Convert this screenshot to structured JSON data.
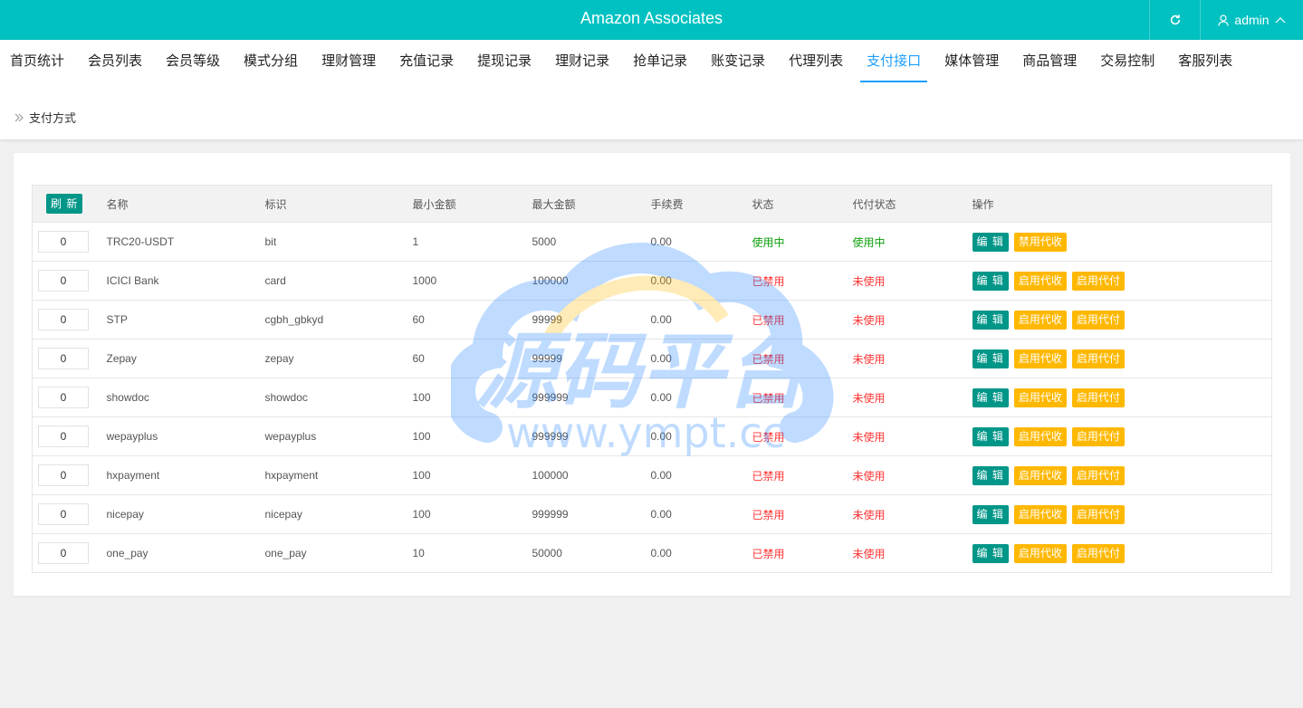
{
  "header": {
    "title": "Amazon Associates",
    "user": "admin"
  },
  "nav": {
    "tabs": [
      "首页统计",
      "会员列表",
      "会员等级",
      "模式分组",
      "理财管理",
      "充值记录",
      "提现记录",
      "理财记录",
      "抢单记录",
      "账变记录",
      "代理列表",
      "支付接口",
      "媒体管理",
      "商品管理",
      "交易控制",
      "客服列表"
    ],
    "active_index": 11
  },
  "breadcrumb": {
    "label": "支付方式"
  },
  "table": {
    "refresh_label": "刷 新",
    "columns": [
      "名称",
      "标识",
      "最小金额",
      "最大金额",
      "手续费",
      "状态",
      "代付状态",
      "操作"
    ],
    "rows": [
      {
        "sort": "0",
        "name": "TRC20-USDT",
        "code": "bit",
        "min": "1",
        "max": "5000",
        "fee": "0.00",
        "status": "使用中",
        "payout_status": "使用中",
        "actions": [
          "编 辑",
          "禁用代收"
        ]
      },
      {
        "sort": "0",
        "name": "ICICI Bank",
        "code": "card",
        "min": "1000",
        "max": "100000",
        "fee": "0.00",
        "status": "已禁用",
        "payout_status": "未使用",
        "actions": [
          "编 辑",
          "启用代收",
          "启用代付"
        ]
      },
      {
        "sort": "0",
        "name": "STP",
        "code": "cgbh_gbkyd",
        "min": "60",
        "max": "99999",
        "fee": "0.00",
        "status": "已禁用",
        "payout_status": "未使用",
        "actions": [
          "编 辑",
          "启用代收",
          "启用代付"
        ]
      },
      {
        "sort": "0",
        "name": "Zepay",
        "code": "zepay",
        "min": "60",
        "max": "99999",
        "fee": "0.00",
        "status": "已禁用",
        "payout_status": "未使用",
        "actions": [
          "编 辑",
          "启用代收",
          "启用代付"
        ]
      },
      {
        "sort": "0",
        "name": "showdoc",
        "code": "showdoc",
        "min": "100",
        "max": "999999",
        "fee": "0.00",
        "status": "已禁用",
        "payout_status": "未使用",
        "actions": [
          "编 辑",
          "启用代收",
          "启用代付"
        ]
      },
      {
        "sort": "0",
        "name": "wepayplus",
        "code": "wepayplus",
        "min": "100",
        "max": "999999",
        "fee": "0.00",
        "status": "已禁用",
        "payout_status": "未使用",
        "actions": [
          "编 辑",
          "启用代收",
          "启用代付"
        ]
      },
      {
        "sort": "0",
        "name": "hxpayment",
        "code": "hxpayment",
        "min": "100",
        "max": "100000",
        "fee": "0.00",
        "status": "已禁用",
        "payout_status": "未使用",
        "actions": [
          "编 辑",
          "启用代收",
          "启用代付"
        ]
      },
      {
        "sort": "0",
        "name": "nicepay",
        "code": "nicepay",
        "min": "100",
        "max": "999999",
        "fee": "0.00",
        "status": "已禁用",
        "payout_status": "未使用",
        "actions": [
          "编 辑",
          "启用代收",
          "启用代付"
        ]
      },
      {
        "sort": "0",
        "name": "one_pay",
        "code": "one_pay",
        "min": "10",
        "max": "50000",
        "fee": "0.00",
        "status": "已禁用",
        "payout_status": "未使用",
        "actions": [
          "编 辑",
          "启用代收",
          "启用代付"
        ]
      }
    ]
  },
  "watermark": {
    "text": "源码平台",
    "url": "www.ympt.cc"
  },
  "colors": {
    "topbar": "#00c1c1",
    "active_tab": "#1e9fff",
    "edit_button": "#009688",
    "warn_button": "#ffb800",
    "status_on": "#0aa00a",
    "status_off": "#ff3333"
  },
  "icons": {
    "refresh": "refresh-icon",
    "user": "user-icon",
    "chevron": "chevron-up-icon",
    "breadcrumb": "double-chevron-right-icon"
  }
}
